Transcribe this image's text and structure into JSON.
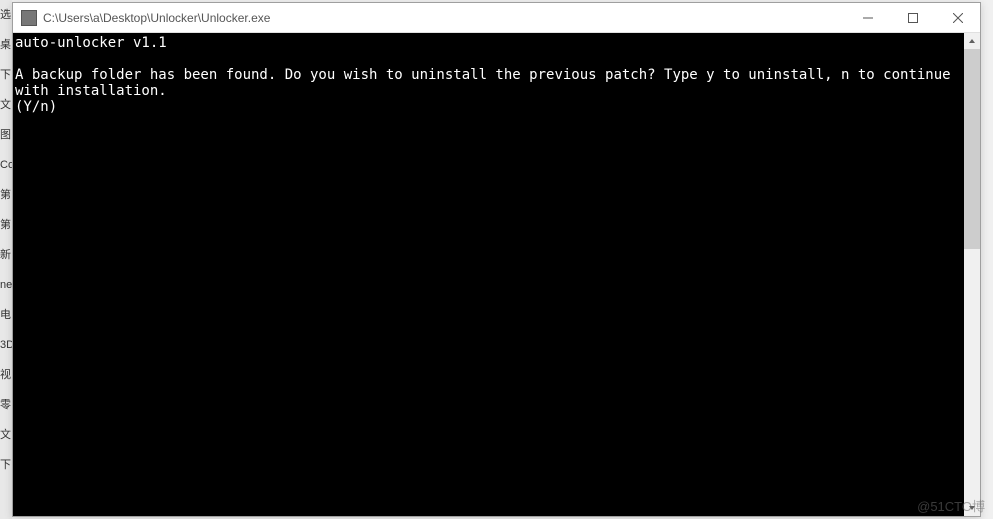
{
  "window": {
    "title": "C:\\Users\\a\\Desktop\\Unlocker\\Unlocker.exe"
  },
  "console": {
    "line1": "auto-unlocker v1.1",
    "line2": "",
    "line3": "A backup folder has been found. Do you wish to uninstall the previous patch? Type y to uninstall, n to continue with installation.",
    "line4": "(Y/n)"
  },
  "desktop": {
    "frag1": "选",
    "frag2": "桌",
    "frag3": "下",
    "frag4": "文",
    "frag5": "图",
    "frag6": "Co",
    "frag7": "第",
    "frag8": "第",
    "frag9": "新",
    "frag10": "ne",
    "frag11": "电",
    "frag12": "3D",
    "frag13": "视",
    "frag14": "零",
    "frag15": "文",
    "frag16": "下"
  },
  "watermark": "@51CTO博"
}
